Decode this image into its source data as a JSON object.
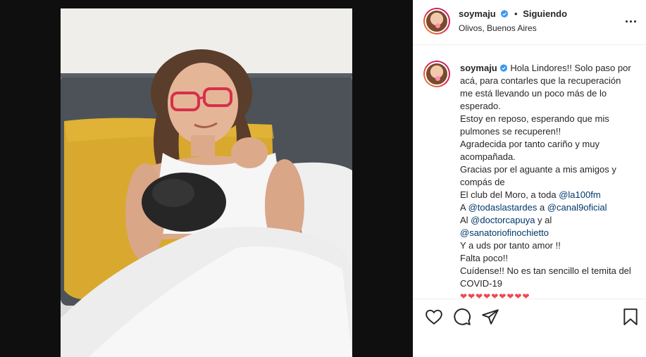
{
  "post": {
    "username": "soymaju",
    "follow_status": "Siguiendo",
    "separator": "•",
    "location": "Olivos, Buenos Aires"
  },
  "caption": {
    "username": "soymaju",
    "greeting": "Hola Lindores!!",
    "line1": "Solo paso por acá, para contarles que la recuperación me está llevando un poco más de lo esperado.",
    "line2": "Estoy en reposo, esperando que mis pulmones se recuperen!!",
    "line3": "Agradecida por tanto cariño y muy acompañada.",
    "line4": "Gracias por el aguante a mis amigos y compás de",
    "line5_text": "El club del Moro, a toda ",
    "mention_la100": "@la100fm",
    "line6_prefix": "A ",
    "mention_todas": "@todaslastardes",
    "line6_mid": " a ",
    "mention_canal9": "@canal9oficial",
    "line7_prefix": "Al ",
    "mention_doctor": "@doctorcapuya",
    "line7_suffix": " y al",
    "mention_sanatorio": "@sanatoriofinochietto",
    "line8": "Y a uds por tanto amor !!",
    "line9": "Falta poco!!",
    "line10": "Cuídense!! No es tan sencillo el temita del COVID-19",
    "hearts": "❤❤❤❤❤❤❤❤❤"
  },
  "icons": {
    "more": "more-options-icon",
    "like": "heart-icon",
    "comment": "comment-icon",
    "share": "share-icon",
    "save": "bookmark-icon",
    "verified": "verified-badge-icon"
  },
  "colors": {
    "text": "#262626",
    "mention": "#00376b",
    "verified": "#3897f0",
    "heart": "#ed4956"
  }
}
